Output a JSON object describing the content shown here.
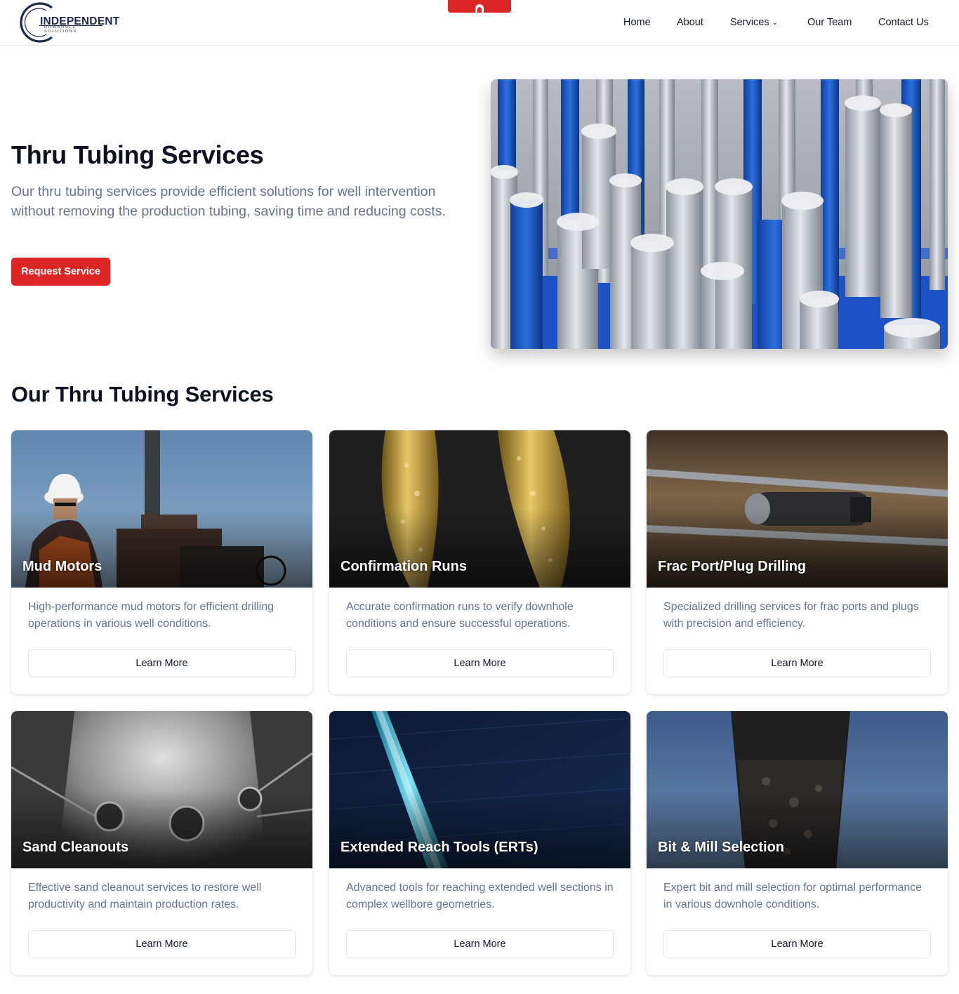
{
  "header": {
    "logo_text": "INDEPENDENT",
    "logo_subtext": "DOWNHOLE SOLUTIONS",
    "nav": [
      {
        "label": "Home"
      },
      {
        "label": "About"
      },
      {
        "label": "Services",
        "chevron": "⌄"
      },
      {
        "label": "Our Team"
      },
      {
        "label": "Contact Us"
      }
    ]
  },
  "hero": {
    "title": "Thru Tubing Services",
    "description": "Our thru tubing services provide efficient solutions for well intervention without removing the production tubing, saving time and reducing costs.",
    "button_label": "Request Service"
  },
  "services_section": {
    "title": "Our Thru Tubing Services",
    "cards": [
      {
        "title": "Mud Motors",
        "description": "High-performance mud motors for efficient drilling operations in various well conditions.",
        "button_label": "Learn More"
      },
      {
        "title": "Confirmation Runs",
        "description": "Accurate confirmation runs to verify downhole conditions and ensure successful operations.",
        "button_label": "Learn More"
      },
      {
        "title": "Frac Port/Plug Drilling",
        "description": "Specialized drilling services for frac ports and plugs with precision and efficiency.",
        "button_label": "Learn More"
      },
      {
        "title": "Sand Cleanouts",
        "description": "Effective sand cleanout services to restore well productivity and maintain production rates.",
        "button_label": "Learn More"
      },
      {
        "title": "Extended Reach Tools (ERTs)",
        "description": "Advanced tools for reaching extended well sections in complex wellbore geometries.",
        "button_label": "Learn More"
      },
      {
        "title": "Bit & Mill Selection",
        "description": "Expert bit and mill selection for optimal performance in various downhole conditions.",
        "button_label": "Learn More"
      }
    ]
  },
  "colors": {
    "accent": "#dc2626",
    "navy": "#1b2a4a",
    "muted_text": "#64748b"
  }
}
